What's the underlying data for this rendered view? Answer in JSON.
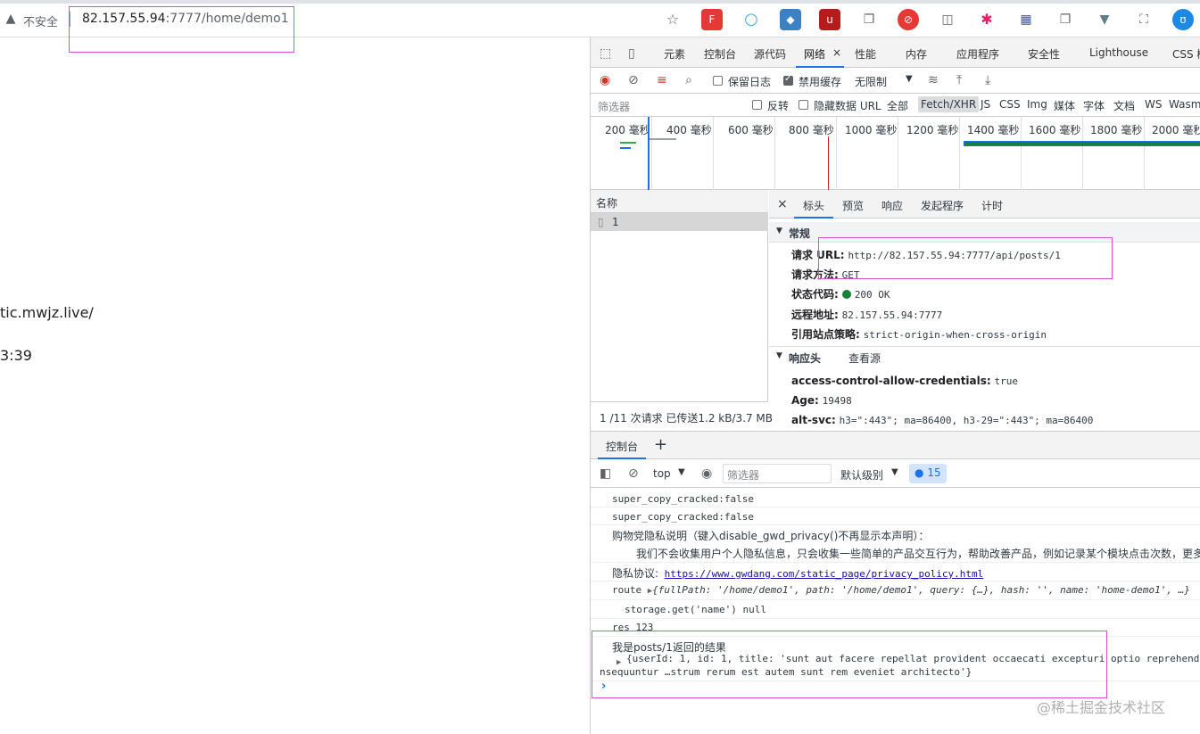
{
  "browser": {
    "security_label": "不安全",
    "url_host": "82.157.55.94",
    "url_rest": ":7777/home/demo1"
  },
  "page": {
    "line1": "tic.mwjz.live/",
    "line2": "3:39"
  },
  "devtools": {
    "tabs": [
      "元素",
      "控制台",
      "源代码",
      "网络",
      "性能",
      "内存",
      "应用程序",
      "安全性",
      "Lighthouse",
      "CSS 概"
    ],
    "active_tab": "网络",
    "close_tab": "×",
    "network_toolbar": {
      "preserve_log": "保留日志",
      "disable_cache": "禁用缓存",
      "throttle": "无限制",
      "throttle_arrow": "▼"
    },
    "filter": {
      "placeholder": "筛选器",
      "invert": "反转",
      "hide_data_urls": "隐藏数据 URL",
      "types": [
        "全部",
        "Fetch/XHR",
        "JS",
        "CSS",
        "Img",
        "媒体",
        "字体",
        "文档",
        "WS",
        "Wasm"
      ]
    },
    "timeline": {
      "labels": [
        "200 毫秒",
        "400 毫秒",
        "600 毫秒",
        "800 毫秒",
        "1000 毫秒",
        "1200 毫秒",
        "1400 毫秒",
        "1600 毫秒",
        "1800 毫秒",
        "2000 毫秒"
      ]
    },
    "names": {
      "header": "名称",
      "row": "1",
      "footer": "1 /11 次请求  已传送1.2 kB/3.7 MB"
    },
    "detail_tabs": [
      "标头",
      "预览",
      "响应",
      "发起程序",
      "计时"
    ],
    "general": {
      "title": "常规",
      "request_url_k": "请求 URL:",
      "request_url_v": "http://82.157.55.94:7777/api/posts/1",
      "method_k": "请求方法:",
      "method_v": "GET",
      "status_k": "状态代码:",
      "status_v": "200 OK",
      "remote_k": "远程地址:",
      "remote_v": "82.157.55.94:7777",
      "referrer_k": "引用站点策略:",
      "referrer_v": "strict-origin-when-cross-origin"
    },
    "response_headers": {
      "title": "响应头",
      "view_source": "查看源",
      "h1_k": "access-control-allow-credentials:",
      "h1_v": "true",
      "h2_k": "Age:",
      "h2_v": "19498",
      "h3_k": "alt-svc:",
      "h3_v": "h3=\":443\"; ma=86400, h3-29=\":443\"; ma=86400"
    }
  },
  "console": {
    "tab": "控制台",
    "add": "+",
    "context": "top",
    "context_arrow": "▼",
    "filter_placeholder": "筛选器",
    "level": "默认级别",
    "level_arrow": "▼",
    "badge_count": "15",
    "lines": {
      "l1": "super_copy_cracked:false",
      "l2": "super_copy_cracked:false",
      "l3": "购物党隐私说明（键入disable_gwd_privacy()不再显示本声明）：",
      "l4": "我们不会收集用户个人隐私信息，只会收集一些简单的产品交互行为，帮助改善产品，例如记录某个模块点击次数，更多",
      "l5_label": "隐私协议:",
      "l5_link": "https://www.gwdang.com/static_page/privacy_policy.html",
      "l6_label": "route",
      "l6_obj": "{fullPath: '/home/demo1', path: '/home/demo1', query: {…}, hash: '', name: 'home-demo1', …}",
      "l7": "storage.get('name') null",
      "l8": "res 123",
      "l9": "我是posts/1返回的结果",
      "l10": "{userId: 1, id: 1, title: 'sunt aut facere repellat provident occaecati excepturi optio reprehende",
      "l11": "nsequuntur …strum rerum est autem sunt rem eveniet architecto'}"
    }
  },
  "watermark": "@稀土掘金技术社区"
}
